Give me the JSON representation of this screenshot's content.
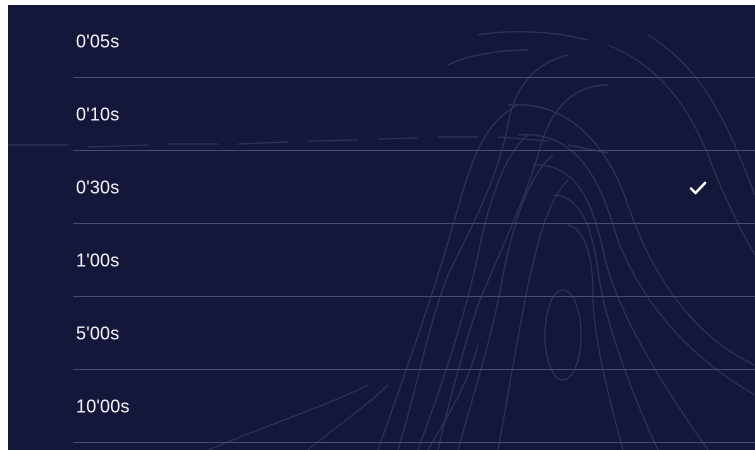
{
  "options": [
    {
      "label": "0'05s",
      "selected": false
    },
    {
      "label": "0'10s",
      "selected": false
    },
    {
      "label": "0'30s",
      "selected": true
    },
    {
      "label": "1'00s",
      "selected": false
    },
    {
      "label": "5'00s",
      "selected": false
    },
    {
      "label": "10'00s",
      "selected": false
    }
  ],
  "check_icon": "checkmark-icon",
  "colors": {
    "background": "#15173a",
    "divider": "#4a4d6d",
    "text": "#f2f3f8",
    "check": "#ffffff"
  }
}
